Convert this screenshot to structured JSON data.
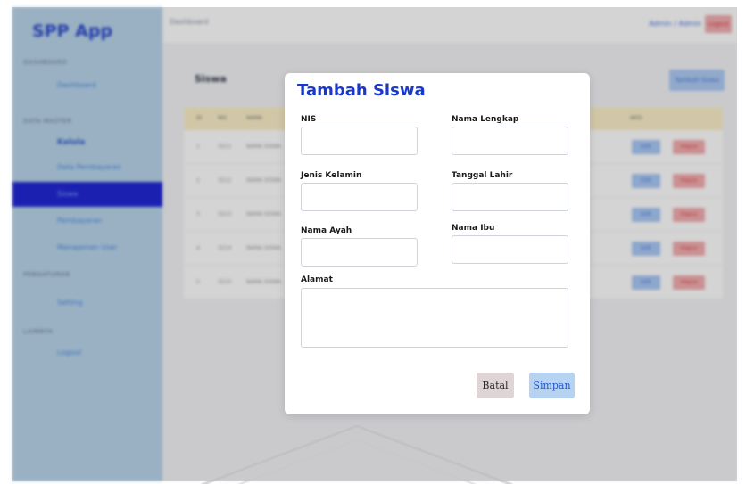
{
  "app": {
    "brand": "SPP App"
  },
  "sidebar": {
    "sections": [
      {
        "heading": "DASHBOARD",
        "items": [
          {
            "label": "Dashboard",
            "style": "normal"
          }
        ]
      },
      {
        "heading": "DATA MASTER",
        "items": [
          {
            "label": "Kelola",
            "style": "bold"
          },
          {
            "label": "Data Pembayaran",
            "style": "normal"
          },
          {
            "label": "Siswa",
            "style": "active"
          },
          {
            "label": "Pembayaran",
            "style": "normal"
          },
          {
            "label": "Manajemen User",
            "style": "normal"
          }
        ]
      },
      {
        "heading": "PENGATURAN",
        "items": [
          {
            "label": "Setting",
            "style": "normal"
          }
        ]
      },
      {
        "heading": "LAINNYA",
        "items": [
          {
            "label": "Logout",
            "style": "normal"
          }
        ]
      }
    ]
  },
  "topbar": {
    "breadcrumb": "Dashboard",
    "user": "Admin / Admin",
    "logout": "Logout"
  },
  "content": {
    "title": "Siswa",
    "add_button": "Tambah Siswa",
    "table": {
      "headers": [
        "ID",
        "NIS",
        "NAMA",
        "",
        "AKSI"
      ],
      "rows": [
        {
          "no": "1",
          "nis": "3211",
          "nama": "NAMA SISWA",
          "extra": "",
          "edit": "Edit",
          "delete": "Hapus"
        },
        {
          "no": "2",
          "nis": "3212",
          "nama": "NAMA SISWA",
          "extra": "",
          "edit": "Edit",
          "delete": "Hapus"
        },
        {
          "no": "3",
          "nis": "3213",
          "nama": "NAMA SISWA",
          "extra": "",
          "edit": "Edit",
          "delete": "Hapus"
        },
        {
          "no": "4",
          "nis": "3214",
          "nama": "NAMA SISWA",
          "extra": "",
          "edit": "Edit",
          "delete": "Hapus"
        },
        {
          "no": "5",
          "nis": "3215",
          "nama": "NAMA SISWA",
          "extra": "",
          "edit": "Edit",
          "delete": "Hapus"
        }
      ]
    }
  },
  "modal": {
    "title": "Tambah Siswa",
    "fields": {
      "nis": {
        "label": "NIS",
        "value": ""
      },
      "nama_lengkap": {
        "label": "Nama Lengkap",
        "value": ""
      },
      "jenis_kelamin": {
        "label": "Jenis Kelamin",
        "value": ""
      },
      "tanggal_lahir": {
        "label": "Tanggal Lahir",
        "value": ""
      },
      "nama_ayah": {
        "label": "Nama Ayah",
        "value": ""
      },
      "nama_ibu": {
        "label": "Nama Ibu",
        "value": ""
      },
      "alamat": {
        "label": "Alamat",
        "value": ""
      }
    },
    "buttons": {
      "cancel": "Batal",
      "save": "Simpan"
    }
  },
  "colors": {
    "sidebar_bg": "#b5d3ea",
    "active_item": "#1219d2",
    "brand": "#1f3fc8",
    "modal_title": "#1838c9",
    "table_header": "#fcefc6",
    "save_button": "#b6d3f1",
    "cancel_button": "#e0d5d6"
  }
}
